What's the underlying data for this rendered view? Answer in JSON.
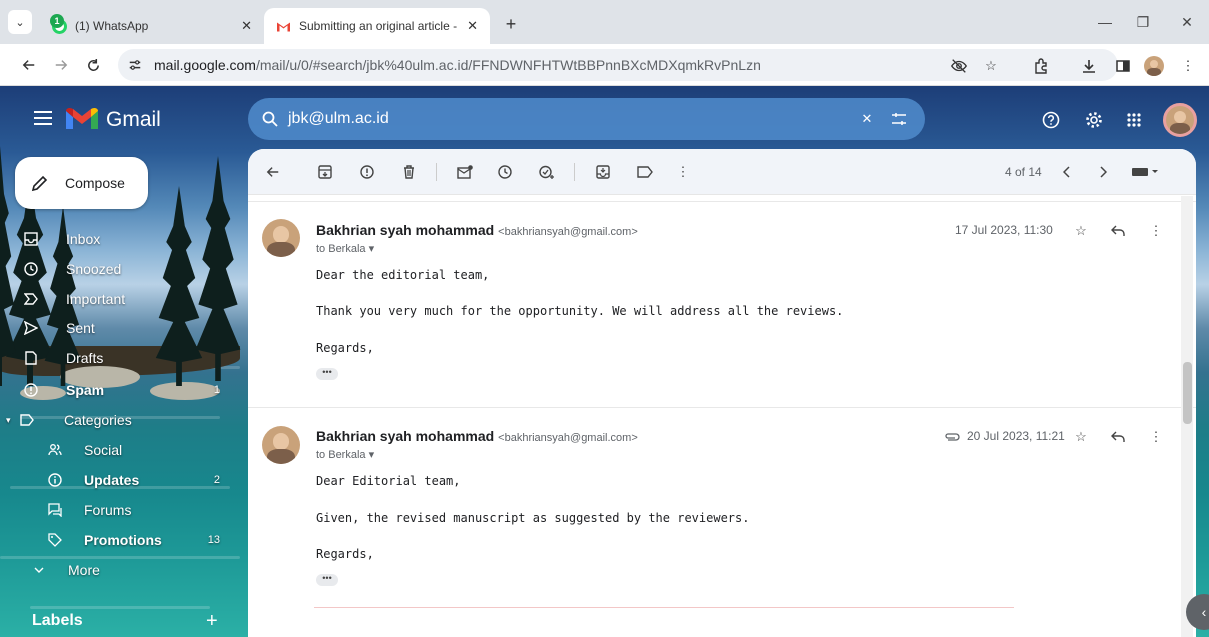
{
  "browser": {
    "tabs": [
      {
        "label": "(1) WhatsApp",
        "badge": "1"
      },
      {
        "label": "Submitting an original article - |"
      }
    ],
    "url_host": "mail.google.com",
    "url_path": "/mail/u/0/#search/jbk%40ulm.ac.id/FFNDWNFHTWtBBPnnBXcMDXqmkRvPnLzn"
  },
  "gmail": {
    "brand": "Gmail",
    "search_query": "jbk@ulm.ac.id",
    "compose_label": "Compose",
    "nav": [
      {
        "label": "Inbox",
        "count": "",
        "icon": "inbox-icon"
      },
      {
        "label": "Snoozed",
        "count": "",
        "icon": "clock-icon"
      },
      {
        "label": "Important",
        "count": "",
        "icon": "important-icon"
      },
      {
        "label": "Sent",
        "count": "",
        "icon": "send-icon"
      },
      {
        "label": "Drafts",
        "count": "",
        "icon": "draft-icon"
      },
      {
        "label": "Spam",
        "count": "1",
        "icon": "spam-icon"
      },
      {
        "label": "Categories",
        "count": "",
        "icon": "label-icon"
      },
      {
        "label": "Social",
        "count": "",
        "icon": "people-icon"
      },
      {
        "label": "Updates",
        "count": "2",
        "icon": "info-icon"
      },
      {
        "label": "Forums",
        "count": "",
        "icon": "forum-icon"
      },
      {
        "label": "Promotions",
        "count": "13",
        "icon": "tag-icon"
      },
      {
        "label": "More",
        "count": "",
        "icon": "chevron-down-icon"
      }
    ],
    "labels_heading": "Labels",
    "pagination": "4 of 14",
    "messages": [
      {
        "sender": "Bakhrian syah mohammad",
        "email": "<bakhriansyah@gmail.com>",
        "to": "to Berkala",
        "date": "17 Jul 2023, 11:30",
        "attachment": false,
        "lines": [
          "Dear the editorial team,",
          "Thank you very much for the opportunity. We will address all the reviews.",
          "Regards,"
        ]
      },
      {
        "sender": "Bakhrian syah mohammad",
        "email": "<bakhriansyah@gmail.com>",
        "to": "to Berkala",
        "date": "20 Jul 2023, 11:21",
        "attachment": true,
        "lines": [
          "Dear Editorial team,",
          "Given, the revised manuscript as suggested by the reviewers.",
          "Regards,"
        ]
      }
    ]
  }
}
